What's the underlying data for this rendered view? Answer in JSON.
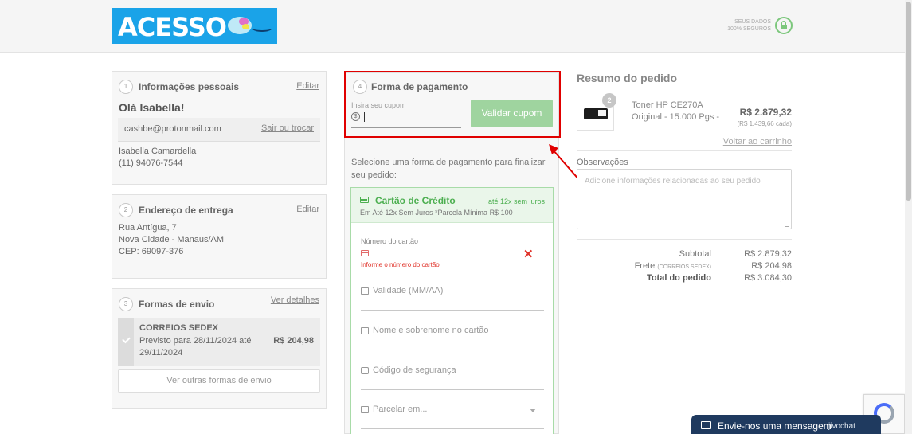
{
  "header": {
    "logo_text": "ACESSO",
    "secure_line1": "SEUS DADOS",
    "secure_line2": "100% SEGUROS"
  },
  "personal": {
    "step": "1",
    "title": "Informações pessoais",
    "edit": "Editar",
    "greeting": "Olá Isabella!",
    "email": "cashbe@protonmail.com",
    "logout": "Sair ou trocar",
    "name": "Isabella Camardella",
    "phone": "(11) 94076-7544"
  },
  "address": {
    "step": "2",
    "title": "Endereço de entrega",
    "edit": "Editar",
    "line1": "Rua Antígua, 7",
    "line2": "Nova Cidade - Manaus/AM",
    "line3": "CEP: 69097-376"
  },
  "shipping": {
    "step": "3",
    "title": "Formas de envio",
    "details": "Ver detalhes",
    "carrier": "CORREIOS SEDEX",
    "eta": "Previsto para 28/11/2024 até 29/11/2024",
    "price": "R$ 204,98",
    "other": "Ver outras formas de envio"
  },
  "payment": {
    "step": "4",
    "title": "Forma de pagamento",
    "coupon_label": "Insira seu cupom",
    "coupon_value": "",
    "coupon_button": "Validar cupom",
    "instruction": "Selecione uma forma de pagamento para finalizar seu pedido:",
    "credit": {
      "title": "Cartão de Crédito",
      "installments": "até 12x sem juros",
      "subtitle": "Em Até 12x Sem Juros *Parcela Mínima R$ 100",
      "card_number_label": "Número do cartão",
      "card_number_error": "Informe o número do cartão",
      "validity_placeholder": "Validade (MM/AA)",
      "name_placeholder": "Nome e sobrenome no cartão",
      "cvv_placeholder": "Código de segurança",
      "installments_placeholder": "Parcelar em..."
    }
  },
  "summary": {
    "title": "Resumo do pedido",
    "qty": "2",
    "product_name": "Toner HP CE270A Original - 15.000 Pgs -",
    "product_price": "R$ 2.879,32",
    "unit_price": "(R$ 1.439,66 cada)",
    "back_to_cart": "Voltar ao carrinho",
    "obs_label": "Observações",
    "obs_placeholder": "Adicione informações relacionadas ao seu pedido",
    "subtotal_label": "Subtotal",
    "subtotal_value": "R$ 2.879,32",
    "freight_label": "Frete",
    "freight_carrier": "(CORREIOS SEDEX)",
    "freight_value": "R$ 204,98",
    "total_label": "Total do pedido",
    "total_value": "R$ 3.084,30"
  },
  "chat": {
    "label": "Envie-nos uma mensagem",
    "brand": "jivochat"
  }
}
